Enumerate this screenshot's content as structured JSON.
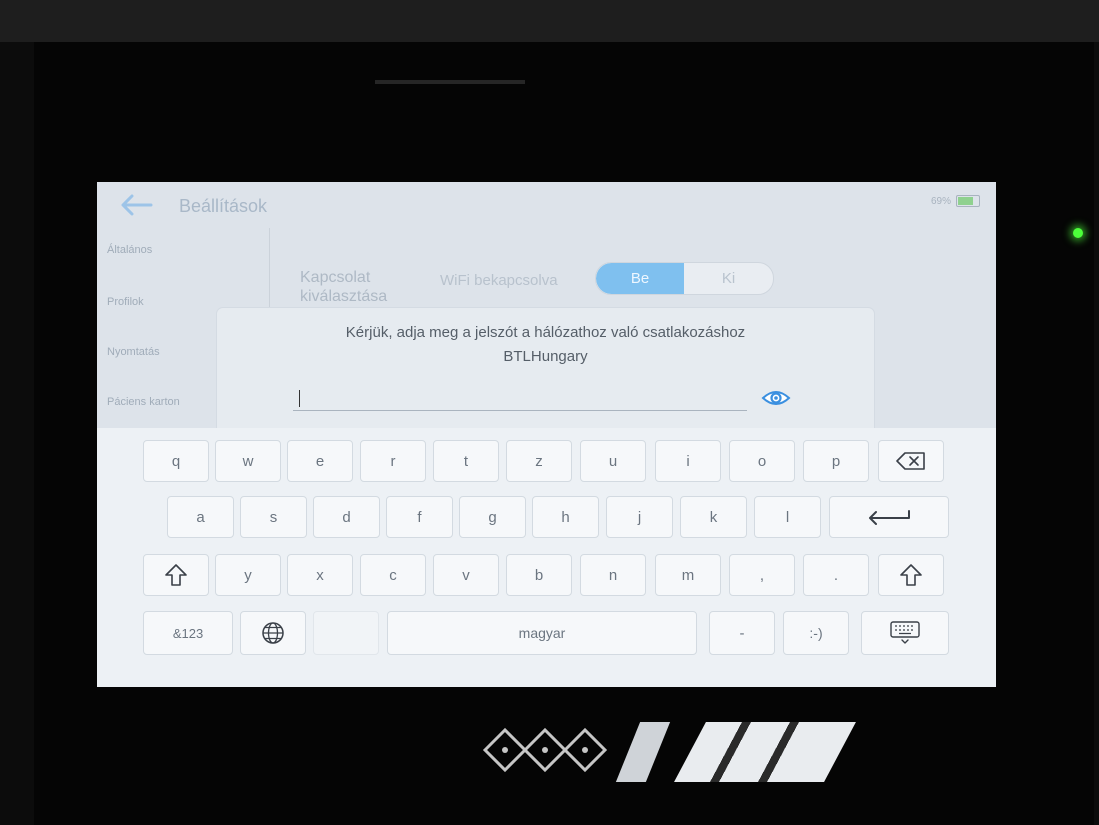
{
  "topbar": {
    "title": "Beállítások",
    "battery_text": "69%",
    "battery_level": 0.69
  },
  "sidebar": {
    "items": [
      "Általános",
      "Profilok",
      "Nyomtatás",
      "Páciens karton"
    ]
  },
  "settings": {
    "connection_label": "Kapcsolat kiválasztása",
    "wifi_label": "WiFi bekapcsolva",
    "toggle_on": "Be",
    "toggle_off": "Ki"
  },
  "dialog": {
    "prompt": "Kérjük, adja meg a jelszót a hálózathoz való csatlakozáshoz",
    "network_name": "BTLHungary",
    "password_value": ""
  },
  "keyboard": {
    "row1": [
      "q",
      "w",
      "e",
      "r",
      "t",
      "z",
      "u",
      "i",
      "o",
      "p"
    ],
    "row2": [
      "a",
      "s",
      "d",
      "f",
      "g",
      "h",
      "j",
      "k",
      "l"
    ],
    "row3": [
      "y",
      "x",
      "c",
      "v",
      "b",
      "n",
      "m",
      ",",
      "."
    ],
    "symbols_label": "&123",
    "space_label": "magyar",
    "dash_label": "-",
    "smiley_label": ":-)"
  },
  "device": {
    "led_color": "#4cff3a",
    "accent": "#7fc0ef"
  }
}
